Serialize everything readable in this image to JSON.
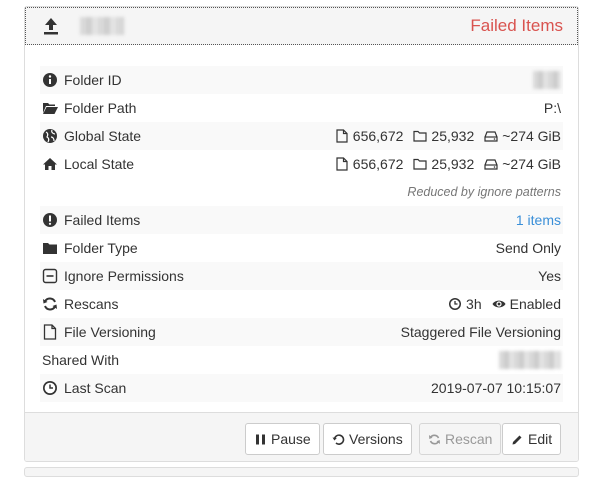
{
  "header": {
    "status": "Failed Items"
  },
  "rows": {
    "folder_id": {
      "label": "Folder ID"
    },
    "folder_path": {
      "label": "Folder Path",
      "value": "P:\\"
    },
    "global_state": {
      "label": "Global State",
      "files": "656,672",
      "dirs": "25,932",
      "size": "~274 GiB"
    },
    "local_state": {
      "label": "Local State",
      "files": "656,672",
      "dirs": "25,932",
      "size": "~274 GiB"
    },
    "reduced_note": "Reduced by ignore patterns",
    "failed_items": {
      "label": "Failed Items",
      "value": "1 items"
    },
    "folder_type": {
      "label": "Folder Type",
      "value": "Send Only"
    },
    "ignore_permissions": {
      "label": "Ignore Permissions",
      "value": "Yes"
    },
    "rescans": {
      "label": "Rescans",
      "interval": "3h",
      "watcher": "Enabled"
    },
    "file_versioning": {
      "label": "File Versioning",
      "value": "Staggered File Versioning"
    },
    "shared_with": {
      "label": "Shared With"
    },
    "last_scan": {
      "label": "Last Scan",
      "value": "2019-07-07 10:15:07"
    }
  },
  "footer": {
    "pause": "Pause",
    "versions": "Versions",
    "rescan": "Rescan",
    "edit": "Edit"
  },
  "colors": {
    "status_error": "#d9534f",
    "link": "#3a8fd8",
    "stripe": "#f9f9f9",
    "heading_bg": "#f5f5f5"
  },
  "icons": {
    "header": "upload-icon",
    "folder_id": "info-circle-icon",
    "folder_path": "folder-open-icon",
    "global_state": "globe-icon",
    "local_state": "home-icon",
    "failed_items": "exclamation-circle-icon",
    "folder_type": "folder-icon",
    "ignore_permissions": "minus-square-icon",
    "rescans": "refresh-icon",
    "file_versioning": "file-icon",
    "last_scan": "clock-icon"
  }
}
